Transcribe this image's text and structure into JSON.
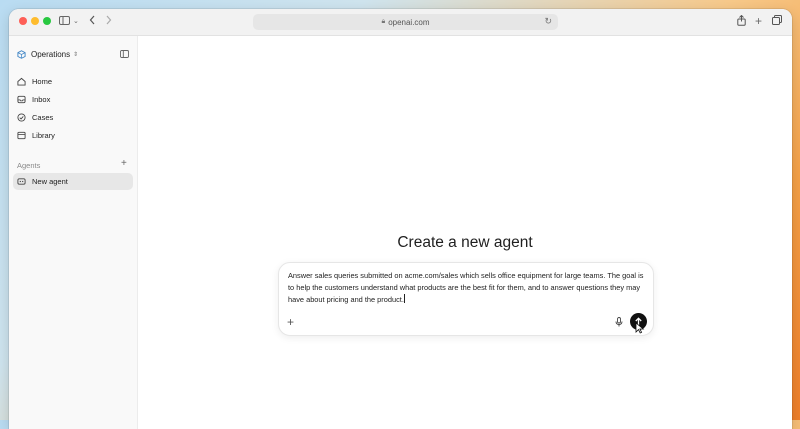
{
  "browser": {
    "url": "openai.com"
  },
  "sidebar": {
    "workspace": "Operations",
    "items": [
      {
        "label": "Home",
        "icon": "home-icon"
      },
      {
        "label": "Inbox",
        "icon": "inbox-icon"
      },
      {
        "label": "Cases",
        "icon": "check-circle-icon"
      },
      {
        "label": "Library",
        "icon": "library-icon"
      }
    ],
    "section_label": "Agents",
    "agents": [
      {
        "label": "New agent",
        "icon": "agent-icon",
        "active": true
      }
    ]
  },
  "main": {
    "heading": "Create a new agent",
    "composer": {
      "text": "Answer sales queries submitted on acme.com/sales which sells office equipment for large teams. The goal is to help the customers understand what products are the best fit for them, and to answer questions they may have about pricing and the product."
    }
  },
  "colors": {
    "window_bg": "#ffffff",
    "sidebar_bg": "#f9f9f9",
    "active_item_bg": "#e7e7e7",
    "send_button": "#111111",
    "workspace_accent": "#3b82c4"
  }
}
